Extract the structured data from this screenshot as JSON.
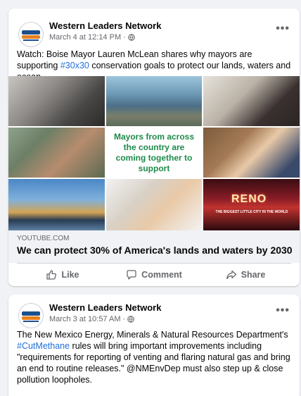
{
  "posts": [
    {
      "page_name": "Western Leaders Network",
      "timestamp": "March 4 at 12:14 PM",
      "meta_separator": "·",
      "text_before": "Watch: Boise Mayor Lauren McLean shares why mayors are supporting ",
      "hashtag": "#30x30",
      "text_after": " conservation goals to protect our lands, waters and ocean.",
      "image_caption": "Mayors from across the country are coming together to support",
      "image_sign_text": "RENO",
      "image_banner_text": "THE BIGGEST LITTLE CITY IN THE WORLD",
      "link_domain": "YOUTUBE.COM",
      "link_title": "We can protect 30% of America's lands and waters by 2030",
      "actions": {
        "like": "Like",
        "comment": "Comment",
        "share": "Share"
      }
    },
    {
      "page_name": "Western Leaders Network",
      "timestamp": "March 3 at 10:57 AM",
      "meta_separator": "·",
      "text_before": "The New Mexico Energy, Minerals & Natural Resources Department's ",
      "hashtag": "#CutMethane",
      "text_after": " rules will bring important improvements including \"requirements for reporting of venting and flaring natural gas and bring an end to routine releases.\" @NMEnvDep must also step up & close pollution loopholes."
    }
  ],
  "colors": {
    "background": "#f0f2f5",
    "hashtag": "#216fdb",
    "secondary_text": "#65676b",
    "caption_green": "#1d8a4a"
  },
  "icons": [
    "globe-icon",
    "more-options-icon",
    "like-icon",
    "comment-icon",
    "share-icon",
    "page-avatar"
  ]
}
